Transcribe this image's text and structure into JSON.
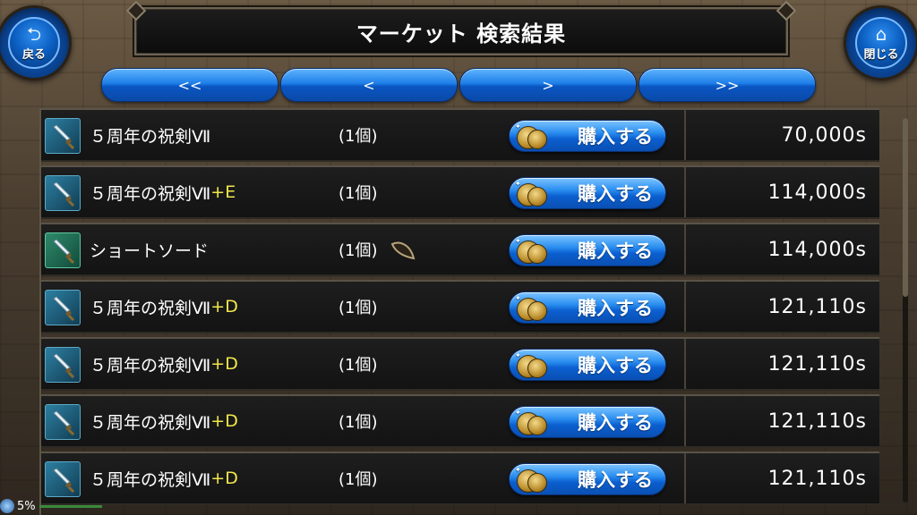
{
  "header": {
    "title": "マーケット 検索結果",
    "back_label": "戻る",
    "close_label": "閉じる"
  },
  "pager": {
    "first": "<<",
    "prev": "<",
    "next": ">",
    "last": ">>"
  },
  "buy_label": "購入する",
  "listings": [
    {
      "name": "５周年の祝剣Ⅶ",
      "suffix": "",
      "qty": "(1個)",
      "price": "70,000s",
      "icon": "sword-icon",
      "mark": false
    },
    {
      "name": "５周年の祝剣Ⅶ",
      "suffix": "+E",
      "qty": "(1個)",
      "price": "114,000s",
      "icon": "sword-icon",
      "mark": false
    },
    {
      "name": "ショートソード",
      "suffix": "",
      "qty": "(1個)",
      "price": "114,000s",
      "icon": "sword-icon",
      "mark": true
    },
    {
      "name": "５周年の祝剣Ⅶ",
      "suffix": "+D",
      "qty": "(1個)",
      "price": "121,110s",
      "icon": "sword-icon",
      "mark": false
    },
    {
      "name": "５周年の祝剣Ⅶ",
      "suffix": "+D",
      "qty": "(1個)",
      "price": "121,110s",
      "icon": "sword-icon",
      "mark": false
    },
    {
      "name": "５周年の祝剣Ⅶ",
      "suffix": "+D",
      "qty": "(1個)",
      "price": "121,110s",
      "icon": "sword-icon",
      "mark": false
    },
    {
      "name": "５周年の祝剣Ⅶ",
      "suffix": "+D",
      "qty": "(1個)",
      "price": "121,110s",
      "icon": "sword-icon",
      "mark": false
    }
  ],
  "status": {
    "percent": "5%"
  }
}
